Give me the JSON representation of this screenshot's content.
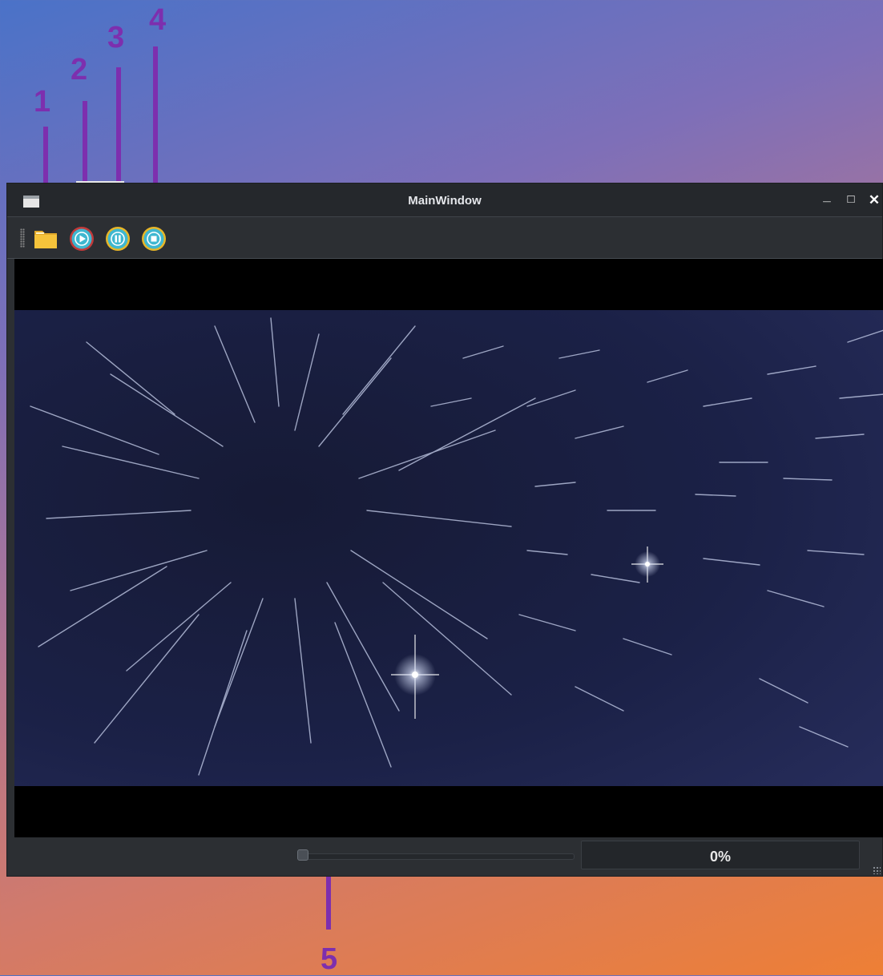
{
  "callouts": [
    "1",
    "2",
    "3",
    "4",
    "5"
  ],
  "window": {
    "title": "MainWindow",
    "minimize_glyph": "_",
    "maximize_glyph": "□",
    "close_glyph": "✕"
  },
  "toolbar": {
    "items": [
      {
        "name": "open",
        "icon": "folder-icon"
      },
      {
        "name": "play",
        "icon": "play-icon"
      },
      {
        "name": "pause",
        "icon": "pause-icon"
      },
      {
        "name": "stop",
        "icon": "stop-icon"
      }
    ]
  },
  "video": {
    "content": "starfield-frame"
  },
  "playback": {
    "position_fraction": 0,
    "progress_label": "0%"
  },
  "colors": {
    "callout": "#7d2fae",
    "window_bg": "#2c2f33",
    "titlebar_bg": "#25282c",
    "folder": "#f5c33b",
    "play_ring": "#c23a3a",
    "pause_ring": "#e7b628",
    "stop_ring": "#3fb7d0",
    "button_face": "#3fb7d0"
  }
}
